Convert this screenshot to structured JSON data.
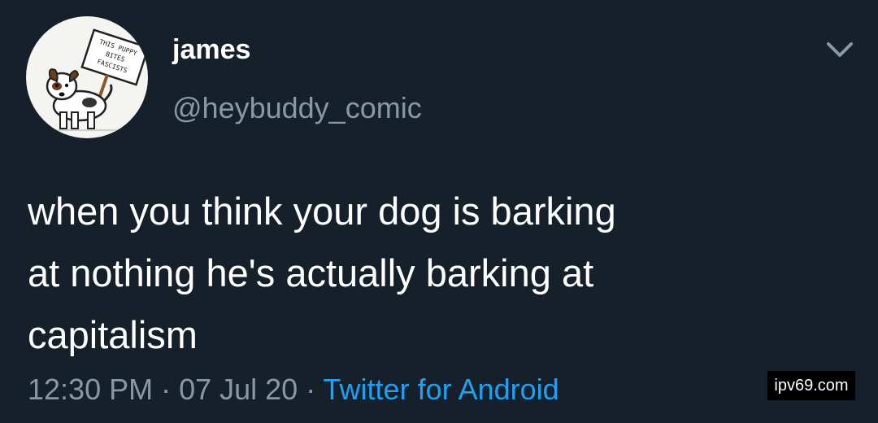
{
  "author": {
    "display_name": "james",
    "handle": "@heybuddy_comic",
    "avatar_icon": "dog-with-protest-sign-avatar",
    "avatar_sign_text": "THIS PUPPY BITES FASCISTS"
  },
  "menu": {
    "icon": "chevron-down-icon"
  },
  "tweet": {
    "lines": [
      "when you think your dog is barking",
      "at nothing he's actually barking at",
      "capitalism"
    ]
  },
  "meta": {
    "time": "12:30 PM",
    "separator": " · ",
    "date": "07 Jul 20",
    "source": "Twitter for Android"
  },
  "watermark": {
    "text": "ipv69.com"
  },
  "colors": {
    "background": "#15202b",
    "text": "#ffffff",
    "secondary": "#8899a6",
    "link": "#1da1f2"
  }
}
